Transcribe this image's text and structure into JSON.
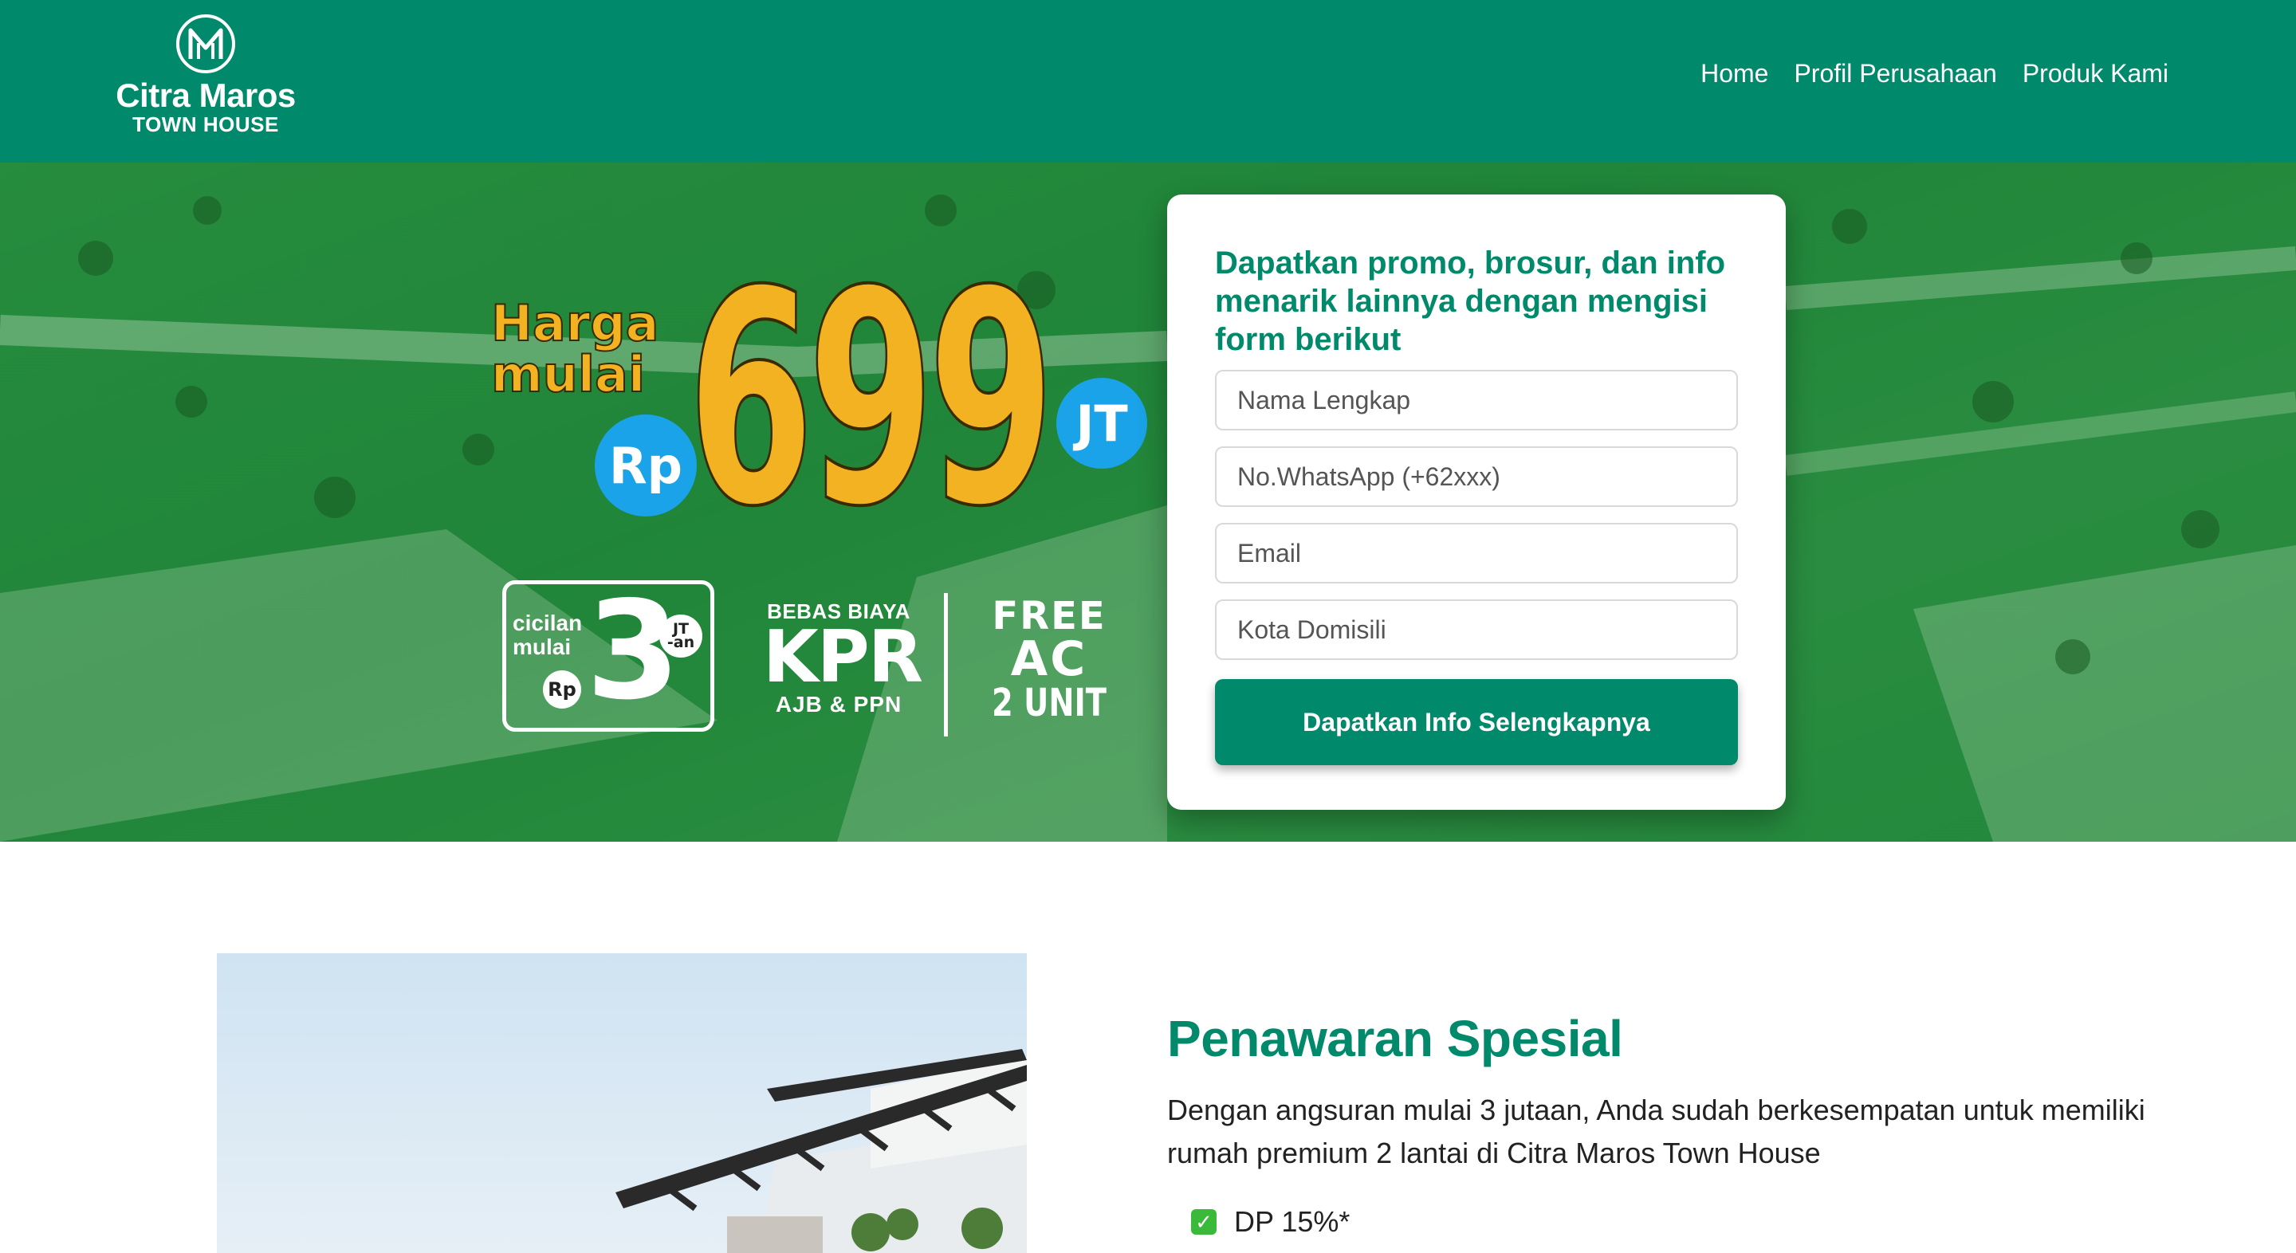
{
  "brand": {
    "name": "Citra Maros",
    "subtitle": "TOWN HOUSE",
    "logo_icon": "m-monogram-circle-icon"
  },
  "colors": {
    "primary": "#008a6b",
    "price_yellow": "#f2b221",
    "badge_blue": "#1aa3e8",
    "check_green": "#3bb93b"
  },
  "nav": {
    "items": [
      {
        "label": "Home"
      },
      {
        "label": "Profil Perusahaan"
      },
      {
        "label": "Produk Kami"
      }
    ]
  },
  "hero": {
    "harga_line1": "Harga",
    "harga_line2": "mulai",
    "currency": "Rp",
    "price": "699",
    "unit": "JT",
    "cicilan_line1": "cicilan",
    "cicilan_line2": "mulai",
    "cicilan_currency": "Rp",
    "cicilan_value": "3",
    "cicilan_unit_line1": "JT",
    "cicilan_unit_line2": "-an",
    "kpr_top": "BEBAS BIAYA",
    "kpr_main": "KPR",
    "kpr_sub": "AJB & PPN",
    "free_line1": "FREE",
    "free_line2": "AC",
    "free_line3": "2 UNIT"
  },
  "form": {
    "title": "Dapatkan promo, brosur, dan info menarik lainnya dengan mengisi form berikut",
    "name_placeholder": "Nama Lengkap",
    "whatsapp_placeholder": "No.WhatsApp (+62xxx)",
    "email_placeholder": "Email",
    "city_placeholder": "Kota Domisili",
    "submit_label": "Dapatkan Info Selengkapnya"
  },
  "offer": {
    "title": "Penawaran Spesial",
    "description": "Dengan angsuran mulai 3 jutaan, Anda sudah berkesempatan untuk memiliki rumah premium 2 lantai di Citra Maros Town House",
    "checklist": [
      {
        "icon": "check-box-icon",
        "label": "DP 15%*"
      }
    ]
  }
}
